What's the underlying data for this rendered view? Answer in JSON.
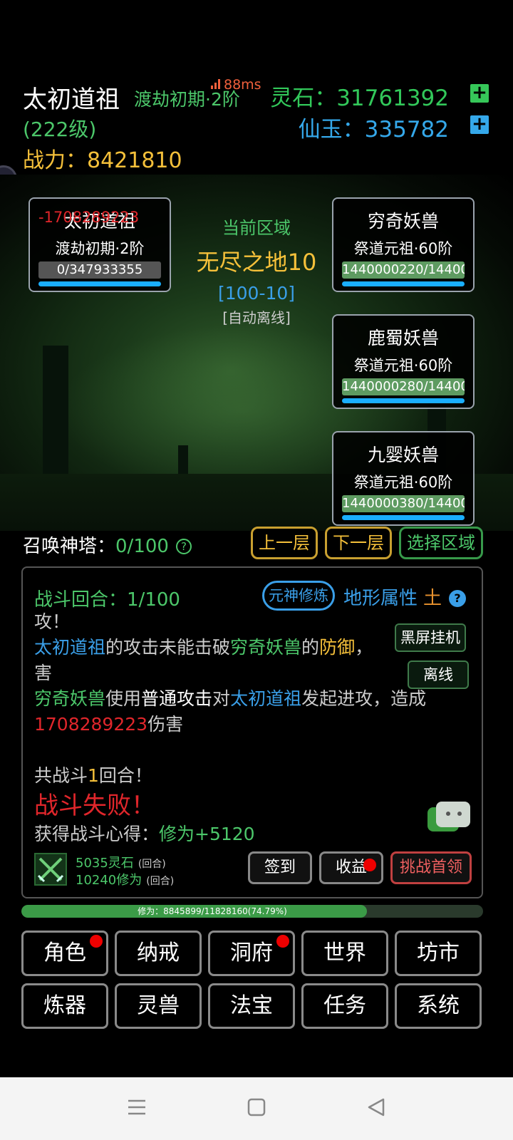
{
  "header": {
    "player_name": "太初道祖",
    "player_realm": "渡劫初期·2阶",
    "ping": "88ms",
    "player_level": "(222级)",
    "power_label": "战力：",
    "power_value": "8421810",
    "lingshi_label": "灵石：",
    "lingshi_value": "31761392",
    "xianyu_label": "仙玉：",
    "xianyu_value": "335782",
    "plus": "+"
  },
  "player_card": {
    "damage_text": "-1708289223",
    "name": "太初道祖",
    "realm": "渡劫初期·2阶",
    "hp": "0/347933355"
  },
  "area": {
    "label": "当前区域",
    "name": "无尽之地10",
    "range": "[100-10]",
    "mode": "[自动离线]"
  },
  "enemies": [
    {
      "name": "穷奇妖兽",
      "realm": "祭道元祖·60阶",
      "hp": "1440000220/14400"
    },
    {
      "name": "鹿蜀妖兽",
      "realm": "祭道元祖·60阶",
      "hp": "1440000280/14400"
    },
    {
      "name": "九婴妖兽",
      "realm": "祭道元祖·60阶",
      "hp": "1440000380/14400"
    }
  ],
  "tower": {
    "label": "召唤神塔：",
    "value": "0/100",
    "help": "?",
    "prev_floor": "上一层",
    "next_floor": "下一层",
    "select_area": "选择区域"
  },
  "battle": {
    "round_label": "战斗回合：",
    "round_value": "1/100",
    "yuanshen_btn": "元神修炼",
    "terrain_label": "地形属性",
    "terrain_element": "土",
    "terrain_help": "?",
    "log_top": "攻！",
    "log1_a": "太初道祖",
    "log1_b": "的攻击未能击破",
    "log1_c": "穷奇妖兽",
    "log1_d": "的",
    "log1_e": "防御",
    "log1_f": "，",
    "log1_g": "害",
    "log2_a": "穷奇妖兽",
    "log2_b": "使用",
    "log2_c": "普通攻击",
    "log2_d": "对",
    "log2_e": "太初道祖",
    "log2_f": "发起进攻，造成",
    "log2_dmg": "1708289223",
    "log2_g": "伤害",
    "total_a": "共战斗",
    "total_n": "1",
    "total_b": "回合！",
    "result": "战斗失败！",
    "gain_label": "获得战斗心得：",
    "gain_value": "修为+5120",
    "black_screen_btn": "黑屏挂机",
    "offline_btn": "离线",
    "reward1": "5035灵石",
    "reward2": "10240修为",
    "reward_per": "(回合)",
    "signin_btn": "签到",
    "income_btn": "收益",
    "challenge_btn": "挑战首领"
  },
  "xp": {
    "text": "修为：8845899/11828160(74.79%)",
    "fraction": 0.7479
  },
  "menu": [
    "角色",
    "纳戒",
    "洞府",
    "世界",
    "坊市",
    "炼器",
    "灵兽",
    "法宝",
    "任务",
    "系统"
  ],
  "sysnav": {
    "menu_icon": "hamburger-icon",
    "home_icon": "square-icon",
    "back_icon": "triangle-back-icon"
  },
  "colors": {
    "accent_green": "#4cc76a",
    "accent_blue": "#3a9fe8",
    "accent_gold": "#f5c03a",
    "danger_red": "#e0262b"
  }
}
